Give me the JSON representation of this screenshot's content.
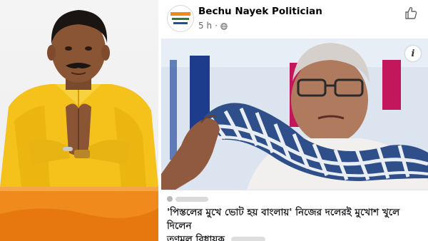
{
  "post": {
    "page_name": "Bechu Nayek Politician",
    "time_ago": "5 h",
    "separator": "·",
    "headline_line1": "'পিস্তলের মুখে ভোট হয় বাংলায়' নিজের দলেরই মুখোশ খুলে দিলেন",
    "headline_line2": "তৃণমূল বিধায়ক",
    "info_badge": "i"
  },
  "icons": {
    "privacy": "globe-icon",
    "like": "thumbs-up-icon",
    "info": "info-icon"
  },
  "colors": {
    "left_background_accent": "#f08a1c",
    "kurta": "#f4c21a",
    "page_name": "#050505",
    "meta_text": "#65676b"
  }
}
